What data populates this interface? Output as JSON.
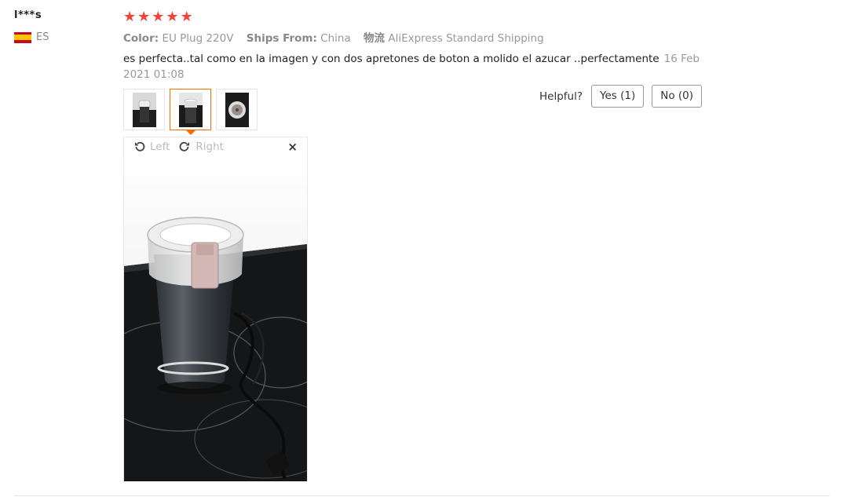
{
  "user": {
    "name": "l***s",
    "country_code": "ES",
    "flag_icon": "spain-flag-icon"
  },
  "review": {
    "rating": 5,
    "rating_max": 5,
    "star_color": "#f44336",
    "color_label": "Color:",
    "color_value": "EU Plug 220V",
    "ships_from_label": "Ships From:",
    "ships_from_value": "China",
    "logistics_label": "物流",
    "logistics_value": "AliExpress Standard Shipping",
    "text": "es perfecta..tal como en la imagen y con dos apretones de boton a molido el azucar ..perfectamente",
    "date": "16 Feb 2021 01:08",
    "thumbnails": [
      {
        "name": "thumbnail-1",
        "active": false
      },
      {
        "name": "thumbnail-2",
        "active": true
      },
      {
        "name": "thumbnail-3",
        "active": false
      }
    ]
  },
  "helpful": {
    "label": "Helpful?",
    "yes": "Yes (1)",
    "no": "No (0)"
  },
  "viewer": {
    "rotate_left": "Left",
    "rotate_right": "Right",
    "close_glyph": "×"
  },
  "colors": {
    "accent": "#ff6a00"
  }
}
